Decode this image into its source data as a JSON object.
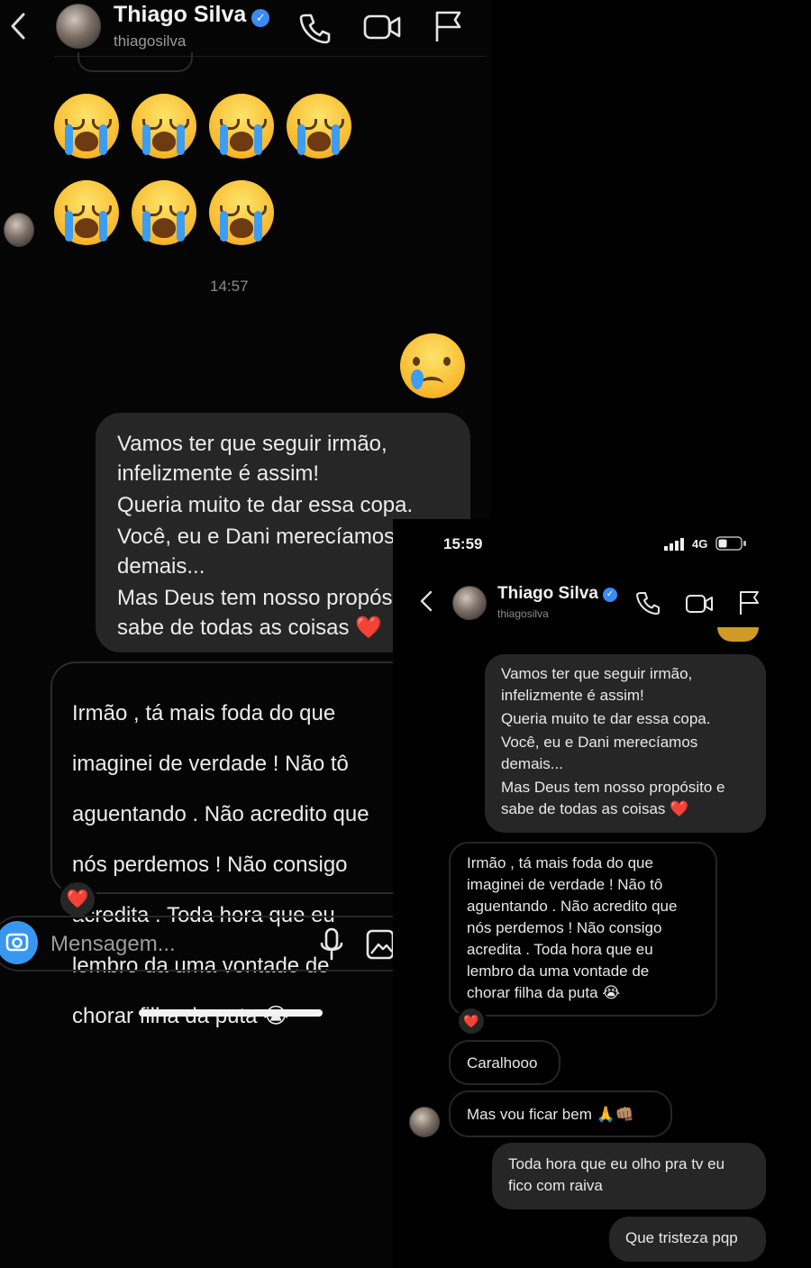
{
  "left_screen": {
    "header": {
      "contact_name": "Thiago Silva",
      "username": "thiagosilva"
    },
    "emoji_rows": [
      [
        "😭",
        "😭",
        "😭",
        "😭"
      ],
      [
        "😭",
        "😭",
        "😭"
      ]
    ],
    "timestamp": "14:57",
    "sent_emoji": "😢",
    "messages": {
      "sent_1": {
        "line1": "Vamos ter que seguir irmão,",
        "line2": "infelizmente é assim!",
        "line3": "Queria muito te dar essa copa.",
        "line4": "Você, eu e Dani merecíamos",
        "line5": "demais...",
        "line6": "Mas Deus tem nosso propós",
        "line7": "sabe de todas as coisas ❤️"
      },
      "received_1": {
        "line1": "Irmão , tá mais foda do que",
        "line2": "imaginei de verdade ! Não tô",
        "line3": "aguentando . Não acredito que",
        "line4": "nós perdemos ! Não consigo",
        "line5": "acredita . Toda hora que eu",
        "line6": "lembro da uma vontade de",
        "line7": "chorar filha da puta 😭"
      },
      "reaction": "❤️"
    },
    "composer": {
      "placeholder": "Mensagem..."
    }
  },
  "right_screen": {
    "status_bar": {
      "time": "15:59",
      "network": "4G"
    },
    "header": {
      "contact_name": "Thiago Silva",
      "username": "thiagosilva"
    },
    "messages": {
      "sent_1": {
        "line1": "Vamos ter que seguir irmão,",
        "line2": "infelizmente é assim!",
        "line3": "Queria muito te dar essa copa.",
        "line4": "Você, eu e Dani merecíamos",
        "line5": "demais...",
        "line6": "Mas Deus tem nosso propósito e",
        "line7": "sabe de todas as coisas ❤️"
      },
      "received_1": {
        "line1": "Irmão , tá mais foda do que",
        "line2": "imaginei de verdade ! Não tô",
        "line3": "aguentando . Não acredito que",
        "line4": "nós perdemos ! Não consigo",
        "line5": "acredita . Toda hora que eu",
        "line6": "lembro da uma vontade de",
        "line7": "chorar filha da puta 😭"
      },
      "reaction": "❤️",
      "received_2": "Caralhooo",
      "received_3": "Mas vou ficar bem 🙏👊🏽",
      "sent_2": {
        "line1": "Toda hora que eu olho pra tv eu",
        "line2": "fico com raiva"
      },
      "sent_3": "Que tristeza pqp"
    }
  },
  "colors": {
    "background": "#000000",
    "bubble_sent": "#262626",
    "verified_blue": "#3a8cf5",
    "heart_red": "#ff2d3f"
  }
}
